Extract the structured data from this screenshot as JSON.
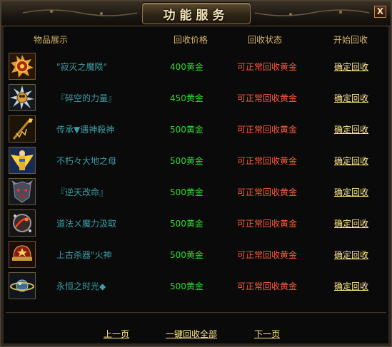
{
  "window": {
    "title": "功能服务",
    "close_label": "X"
  },
  "header": {
    "item": "物品展示",
    "price": "回收价格",
    "status": "回收状态",
    "action": "开始回收"
  },
  "items": [
    {
      "name": "\"寂灭之魔陨\"",
      "price": "400黄金",
      "status": "可正常回收黄金",
      "action": "确定回收",
      "icon": "fire-medallion-icon"
    },
    {
      "name": "『碎空的力量』",
      "price": "450黄金",
      "status": "可正常回收黄金",
      "action": "确定回收",
      "icon": "spiked-orb-icon"
    },
    {
      "name": "传承▼遇神殺神",
      "price": "500黄金",
      "status": "可正常回收黄金",
      "action": "确定回收",
      "icon": "golden-spear-icon"
    },
    {
      "name": "不朽々大地之母",
      "price": "500黄金",
      "status": "可正常回收黄金",
      "action": "确定回收",
      "icon": "winged-goddess-icon"
    },
    {
      "name": "『逆天改命』",
      "price": "500黄金",
      "status": "可正常回收黄金",
      "action": "确定回收",
      "icon": "demon-mask-icon"
    },
    {
      "name": "道法ㄨ魔力汲取",
      "price": "500黄金",
      "status": "可正常回收黄金",
      "action": "确定回收",
      "icon": "dark-orb-icon"
    },
    {
      "name": "上古杀器\"火神",
      "price": "500黄金",
      "status": "可正常回收黄金",
      "action": "确定回收",
      "icon": "war-helmet-icon"
    },
    {
      "name": "永恒之时光◆",
      "price": "500黄金",
      "status": "可正常回收黄金",
      "action": "确定回收",
      "icon": "ringed-planet-icon"
    }
  ],
  "footer": {
    "prev": "上一页",
    "recycle_all": "一键回收全部",
    "next": "下一页"
  },
  "colors": {
    "name": "#3f9ea6",
    "price": "#2fd92f",
    "status": "#ff5a3c",
    "link": "#ffe88a",
    "header": "#d9b56a"
  }
}
